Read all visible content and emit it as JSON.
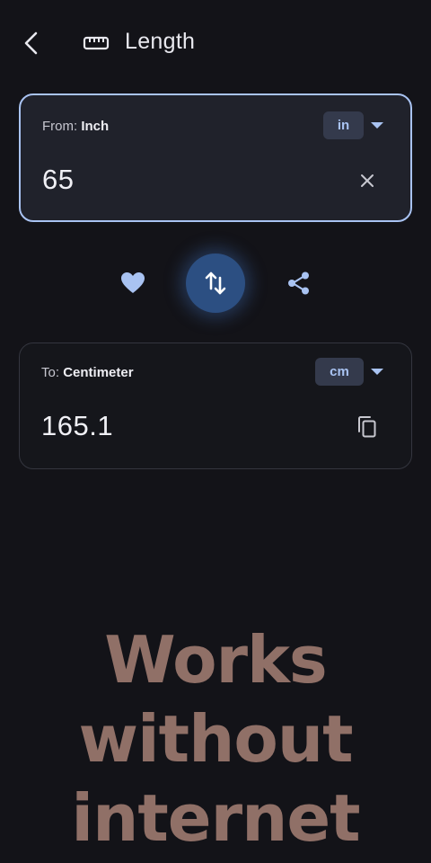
{
  "header": {
    "title": "Length",
    "back_icon": "back-arrow-icon",
    "category_icon": "ruler-icon"
  },
  "from": {
    "label_prefix": "From:",
    "unit_name": "Inch",
    "unit_symbol": "in",
    "value": "65",
    "clear_icon": "close-icon"
  },
  "actions": {
    "favorite_icon": "heart-icon",
    "swap_icon": "swap-vertical-icon",
    "share_icon": "share-icon"
  },
  "to": {
    "label_prefix": "To:",
    "unit_name": "Centimeter",
    "unit_symbol": "cm",
    "value": "165.1",
    "copy_icon": "copy-icon"
  },
  "promo": {
    "line1": "Works",
    "line2": "without",
    "line3": "internet"
  },
  "colors": {
    "background": "#131318",
    "accent": "#a9c3f2",
    "swap_button": "#2c4f82",
    "chip_background": "#343a4c",
    "promo_text": "#907067"
  }
}
